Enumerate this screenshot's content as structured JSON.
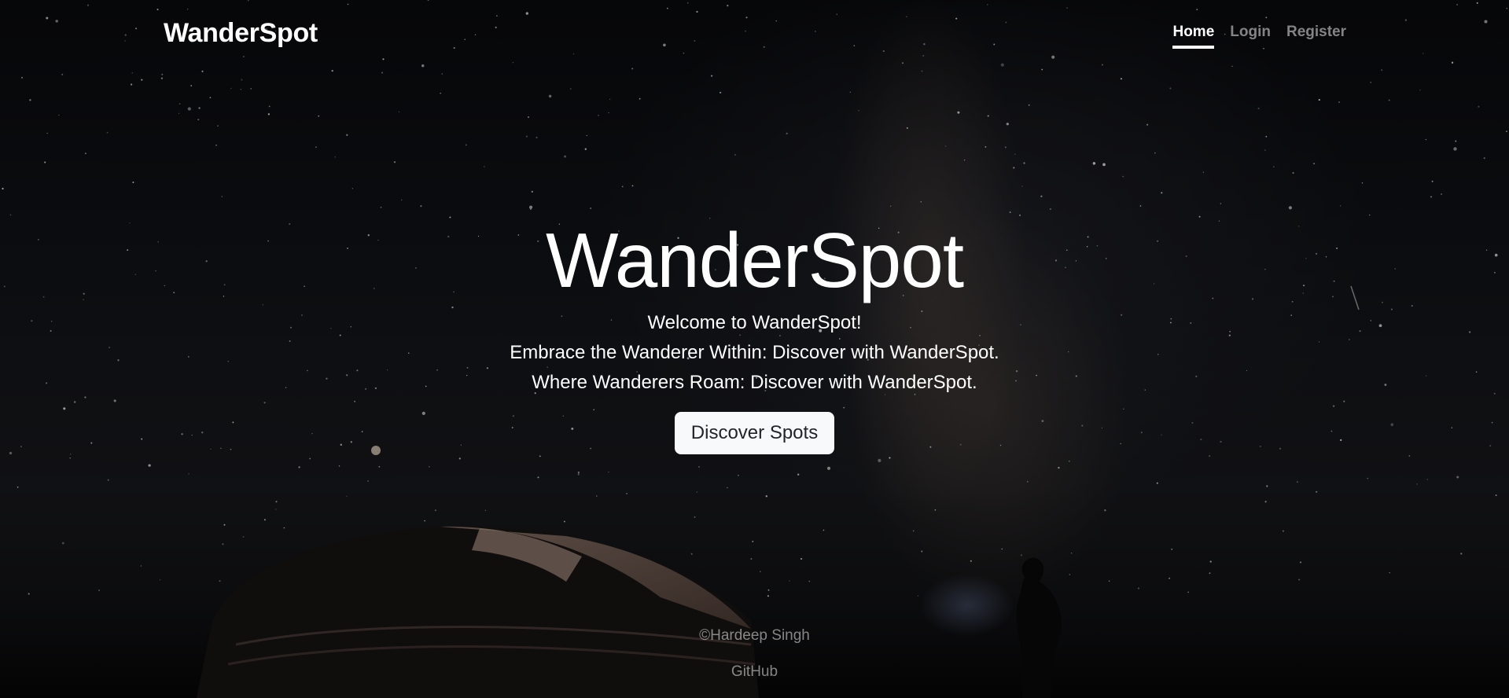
{
  "navbar": {
    "brand": "WanderSpot",
    "links": [
      {
        "label": "Home",
        "active": true
      },
      {
        "label": "Login",
        "active": false
      },
      {
        "label": "Register",
        "active": false
      }
    ]
  },
  "hero": {
    "title": "WanderSpot",
    "lines": [
      "Welcome to WanderSpot!",
      "Embrace the Wanderer Within: Discover with WanderSpot.",
      "Where Wanderers Roam: Discover with WanderSpot."
    ],
    "button_label": "Discover Spots"
  },
  "footer": {
    "copyright": "©Hardeep Singh",
    "github_label": "GitHub"
  },
  "colors": {
    "text": "#ffffff",
    "muted_text": "rgba(255,255,255,0.5)",
    "button_bg": "#f8f9fa",
    "button_text": "#212529"
  }
}
